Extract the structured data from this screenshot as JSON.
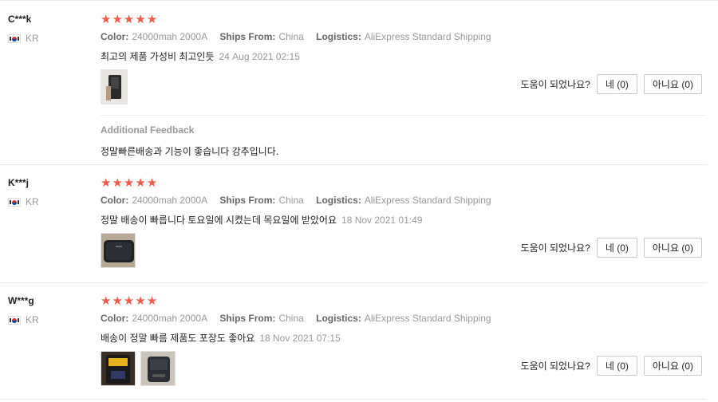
{
  "labels": {
    "color": "Color:",
    "ships_from": "Ships From:",
    "logistics": "Logistics:",
    "helpful_q": "도움이 되었나요?",
    "additional_feedback": "Additional Feedback"
  },
  "reviews": [
    {
      "user": "C***k",
      "country": "KR",
      "stars": "★★★★★",
      "color": "24000mah 2000A",
      "ships_from": "China",
      "logistics": "AliExpress Standard Shipping",
      "text": "최고의 제품 가성비 최고인듯",
      "date": "24 Aug 2021 02:15",
      "yes": "네 (0)",
      "no": "아니요 (0)",
      "additional_text": "정말빠른배송과 기능이 좋습니다 강추입니다."
    },
    {
      "user": "K***j",
      "country": "KR",
      "stars": "★★★★★",
      "color": "24000mah 2000A",
      "ships_from": "China",
      "logistics": "AliExpress Standard Shipping",
      "text": "정말 배송이 빠릅니다 토요일에 시켰는데 목요일에 받았어요",
      "date": "18 Nov 2021 01:49",
      "yes": "네 (0)",
      "no": "아니요 (0)"
    },
    {
      "user": "W***g",
      "country": "KR",
      "stars": "★★★★★",
      "color": "24000mah 2000A",
      "ships_from": "China",
      "logistics": "AliExpress Standard Shipping",
      "text": "배송이 정말 빠름 제품도 포장도 좋아요",
      "date": "18 Nov 2021 07:15",
      "yes": "네 (0)",
      "no": "아니요 (0)"
    }
  ]
}
